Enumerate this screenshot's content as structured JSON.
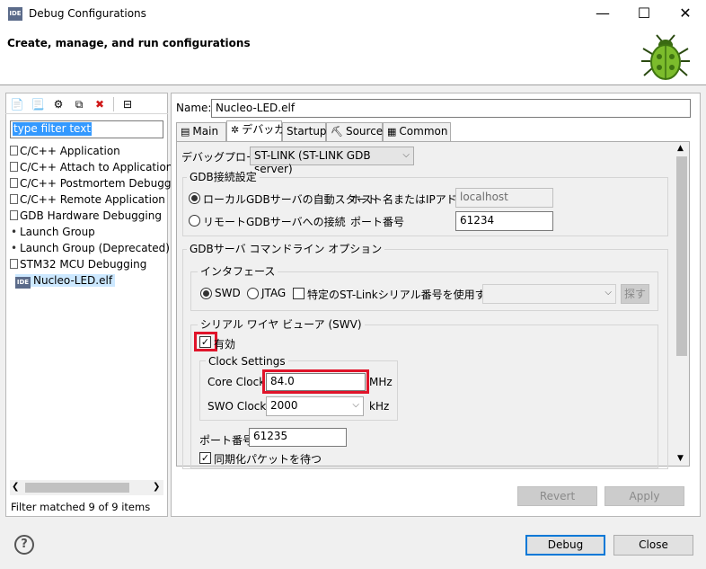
{
  "window": {
    "title": "Debug Configurations",
    "app_icon": "IDE",
    "min_glyph": "—",
    "max_glyph": "☐",
    "close_glyph": "✕"
  },
  "banner": {
    "title": "Create, manage, and run configurations"
  },
  "left": {
    "filter_text": "type filter text",
    "tree": [
      {
        "label": "C/C++ Application",
        "icon": "file-icon"
      },
      {
        "label": "C/C++ Attach to Application",
        "icon": "file-icon"
      },
      {
        "label": "C/C++ Postmortem Debugger",
        "icon": "file-icon"
      },
      {
        "label": "C/C++ Remote Application",
        "icon": "file-icon"
      },
      {
        "label": "GDB Hardware Debugging",
        "icon": "file-icon"
      },
      {
        "label": "Launch Group",
        "icon": "dot-icon"
      },
      {
        "label": "Launch Group (Deprecated)",
        "icon": "dot-icon"
      },
      {
        "label": "STM32 MCU Debugging",
        "icon": "file-icon"
      },
      {
        "label": "Nucleo-LED.elf",
        "icon": "ide-icon"
      }
    ],
    "ide_badge": "IDE",
    "filter_status": "Filter matched 9 of 9 items"
  },
  "right": {
    "name_label": "Name:",
    "name_value": "Nucleo-LED.elf",
    "tabs": [
      "Main",
      "デバッガ",
      "Startup",
      "Source",
      "Common"
    ],
    "probe_label": "デバッグプローブ",
    "probe_value": "ST-LINK (ST-LINK GDB server)",
    "gdb_conn": {
      "title": "GDB接続設定",
      "local_label": "ローカルGDBサーバの自動スタート",
      "host_label": "ホスト名またはIPアドレス",
      "host_value": "localhost",
      "remote_label": "リモートGDBサーバへの接続",
      "port_label": "ポート番号",
      "port_value": "61234"
    },
    "gdb_cmd": {
      "title": "GDBサーバ コマンドライン オプション",
      "iface_title": "インタフェース",
      "swd": "SWD",
      "jtag": "JTAG",
      "serial_label": "特定のST-Linkシリアル番号を使用する",
      "search_btn": "探す",
      "swv_title": "シリアル ワイヤ ビューア (SWV)",
      "enable_label": "有効",
      "clock_title": "Clock Settings",
      "core_clock_label": "Core Clock:",
      "core_clock_value": "84.0",
      "core_clock_unit": "MHz",
      "swo_clock_label": "SWO Clock:",
      "swo_clock_value": "2000",
      "swo_clock_unit": "kHz",
      "port_label": "ポート番号",
      "port_value": "61235",
      "sync_label": "同期化パケットを待つ"
    },
    "revert": "Revert",
    "apply": "Apply"
  },
  "footer": {
    "help": "?",
    "debug": "Debug",
    "close": "Close"
  }
}
